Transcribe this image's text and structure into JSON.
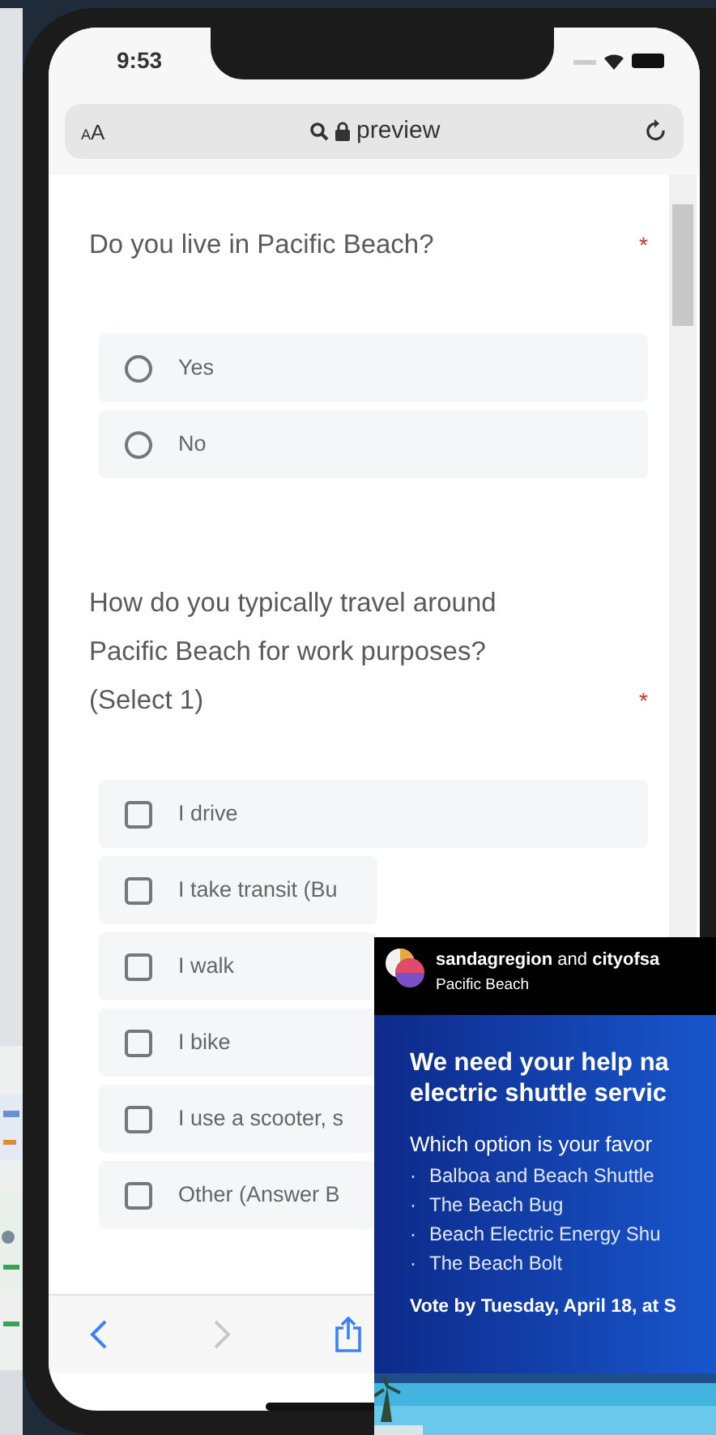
{
  "status_bar": {
    "time": "9:53"
  },
  "address_bar": {
    "text_size": "AA",
    "url": "preview"
  },
  "questions": [
    {
      "text": "Do you live in Pacific Beach?",
      "required_mark": "*",
      "kind": "radio",
      "options": [
        {
          "label": "Yes",
          "selected": false
        },
        {
          "label": "No",
          "selected": false
        }
      ]
    },
    {
      "text": "How do you typically travel around Pacific Beach for work purposes? (Select 1)",
      "required_mark": "*",
      "kind": "checkbox",
      "options": [
        {
          "label": "I drive",
          "checked": false
        },
        {
          "label": "I take transit (Bu",
          "checked": false
        },
        {
          "label": "I walk",
          "checked": false
        },
        {
          "label": "I bike",
          "checked": false
        },
        {
          "label": "I use a scooter, s",
          "checked": false
        },
        {
          "label": "Other (Answer B",
          "checked": false
        }
      ]
    }
  ],
  "instagram_post": {
    "accounts": "**sandagregion** and **cityofsa**",
    "location": "Pacific Beach",
    "headline_lines": [
      "We need your help na",
      "electric shuttle servic"
    ],
    "prompt": "Which option is your favor",
    "options": [
      {
        "bullet": "·",
        "name": "Balboa and Beach Shuttle"
      },
      {
        "bullet": "·",
        "name": "The Beach Bug"
      },
      {
        "bullet": "·",
        "name": "Beach Electric Energy Shu"
      },
      {
        "bullet": "·",
        "name": "The Beach Bolt"
      }
    ],
    "footer": "Vote by Tuesday, April 18, at S"
  }
}
